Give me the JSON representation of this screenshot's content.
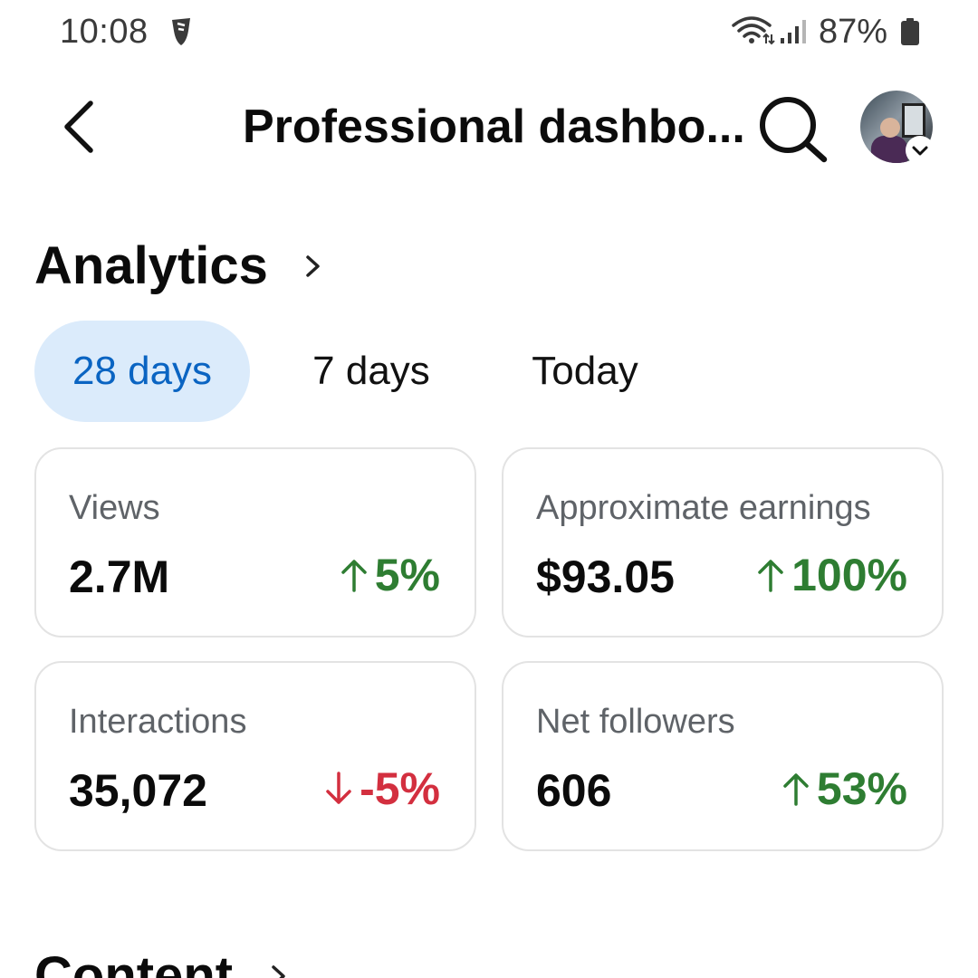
{
  "status_bar": {
    "time": "10:08",
    "battery": "87%",
    "icons": [
      "app-notification-icon",
      "wifi-icon",
      "signal-icon",
      "battery-icon"
    ]
  },
  "header": {
    "title": "Professional dashbo...",
    "icons": [
      "back-arrow-icon",
      "search-icon",
      "chevron-down-icon"
    ]
  },
  "analytics": {
    "title": "Analytics",
    "tabs": [
      {
        "label": "28 days",
        "selected": true
      },
      {
        "label": "7 days",
        "selected": false
      },
      {
        "label": "Today",
        "selected": false
      }
    ],
    "metrics": [
      {
        "label": "Views",
        "value": "2.7M",
        "change": "5%",
        "direction": "up"
      },
      {
        "label": "Approximate earnings",
        "value": "$93.05",
        "change": "100%",
        "direction": "up"
      },
      {
        "label": "Interactions",
        "value": "35,072",
        "change": "-5%",
        "direction": "down"
      },
      {
        "label": "Net followers",
        "value": "606",
        "change": "53%",
        "direction": "up"
      }
    ]
  },
  "content": {
    "title": "Content"
  },
  "colors": {
    "accent": "#0a64c2",
    "tab_active_bg": "#dbebfb",
    "positive": "#2e7d32",
    "negative": "#d32f3f",
    "card_border": "#e3e3e3",
    "secondary_text": "#5f6368"
  }
}
